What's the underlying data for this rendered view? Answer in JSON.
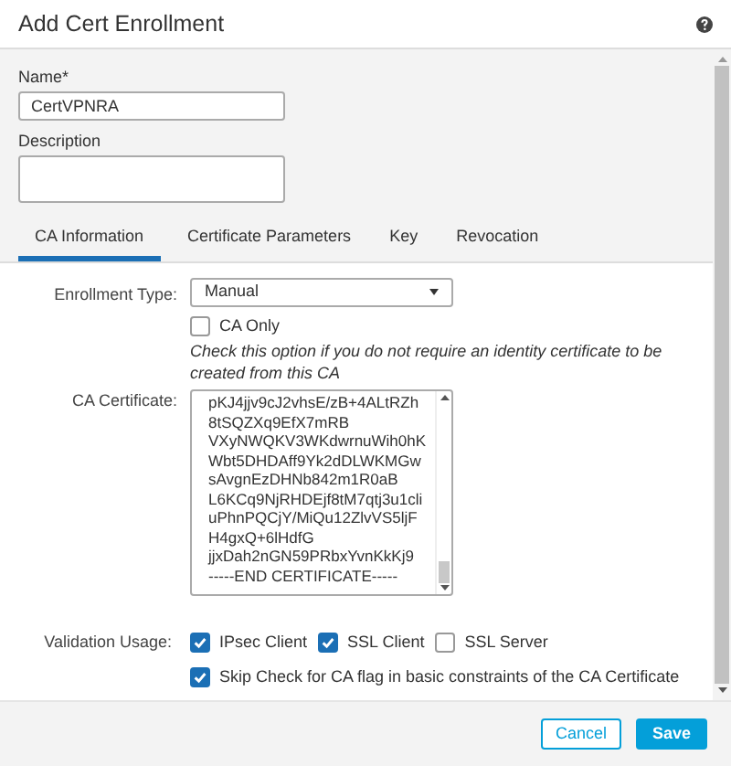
{
  "window": {
    "title": "Add Cert Enrollment"
  },
  "name": {
    "label": "Name*",
    "value": "CertVPNRA"
  },
  "description": {
    "label": "Description"
  },
  "tabs": [
    {
      "label": "CA Information",
      "selected": true
    },
    {
      "label": "Certificate Parameters",
      "selected": false
    },
    {
      "label": "Key",
      "selected": false
    },
    {
      "label": "Revocation",
      "selected": false
    }
  ],
  "enrollment_type": {
    "label": "Enrollment Type:",
    "value": "Manual"
  },
  "ca_only": {
    "label": "CA Only",
    "checked": false,
    "hint": "Check this option if you do not require an identity certificate to be created from this CA"
  },
  "ca_certificate": {
    "label": "CA Certificate:",
    "lines": [
      "pKJ4jjv9cJ2vhsE/zB+4ALtRZh",
      "8tSQZXq9EfX7mRB",
      "VXyNWQKV3WKdwrnuWih0hK",
      "Wbt5DHDAff9Yk2dDLWKMGw",
      "sAvgnEzDHNb842m1R0aB",
      "L6KCq9NjRHDEjf8tM7qtj3u1cli",
      "uPhnPQCjY/MiQu12ZlvVS5ljF",
      "H4gxQ+6lHdfG",
      "jjxDah2nGN59PRbxYvnKkKj9",
      "-----END CERTIFICATE-----"
    ]
  },
  "validation_usage": {
    "label": "Validation Usage:",
    "options": [
      {
        "label": "IPsec Client",
        "checked": true
      },
      {
        "label": "SSL Client",
        "checked": true
      },
      {
        "label": "SSL Server",
        "checked": false
      }
    ]
  },
  "skip_check": {
    "label": "Skip Check for CA flag in basic constraints of the CA Certificate",
    "checked": true
  },
  "buttons": [
    {
      "label": "Cancel",
      "kind": "secondary"
    },
    {
      "label": "Save",
      "kind": "primary"
    }
  ]
}
